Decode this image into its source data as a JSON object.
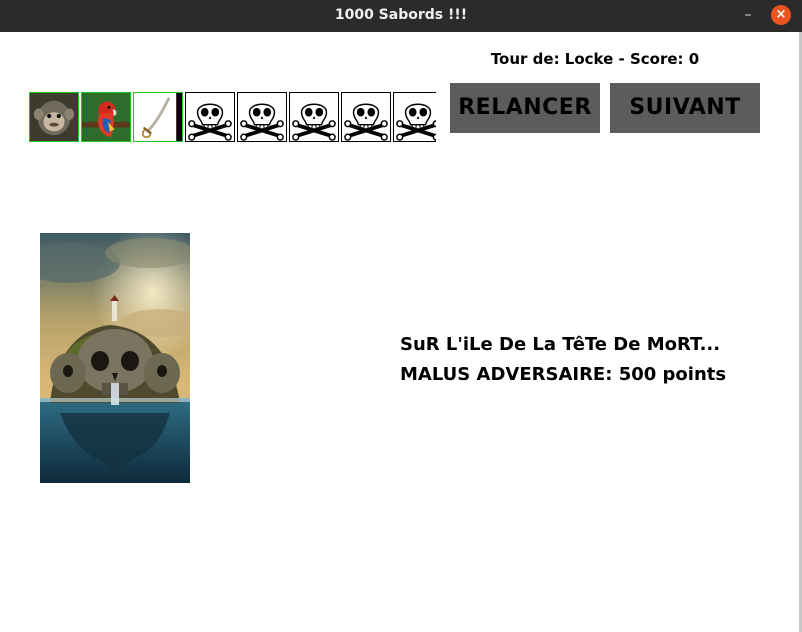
{
  "window": {
    "title": "1000 Sabords !!!",
    "minimize_glyph": "–",
    "close_glyph": "×"
  },
  "turn": {
    "label": "Tour de: Locke - Score: 0"
  },
  "dice": [
    {
      "face": "monkey",
      "icon": "monkey-icon",
      "kept": true
    },
    {
      "face": "parrot",
      "icon": "parrot-icon",
      "kept": true
    },
    {
      "face": "saber",
      "icon": "saber-icon",
      "kept": true
    },
    {
      "face": "skull",
      "icon": "skull-icon",
      "kept": false
    },
    {
      "face": "skull",
      "icon": "skull-icon",
      "kept": false
    },
    {
      "face": "skull",
      "icon": "skull-icon",
      "kept": false
    },
    {
      "face": "skull",
      "icon": "skull-icon",
      "kept": false
    },
    {
      "face": "skull",
      "icon": "skull-icon",
      "kept": false
    }
  ],
  "buttons": {
    "relancer": "RELANCER",
    "suivant": "SUIVANT"
  },
  "card": {
    "image": "skull-island-card",
    "line1": "SuR L'iLe De La TêTe De MoRT...",
    "line2": "MALUS ADVERSAIRE: 500 points"
  },
  "colors": {
    "titlebar": "#2b2b2b",
    "close": "#e95420",
    "button": "#5c5c5c",
    "kept_border": "#22c422"
  }
}
